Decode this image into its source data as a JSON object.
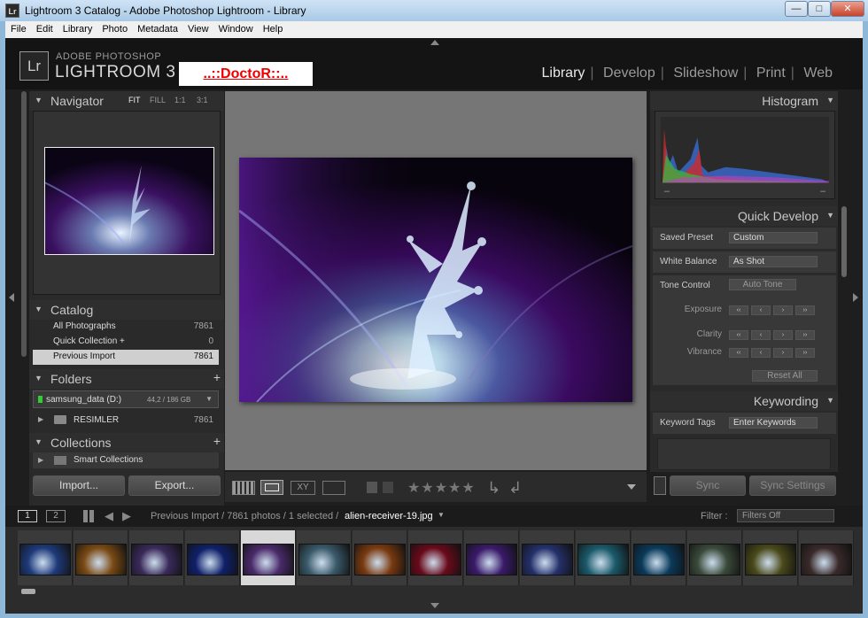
{
  "window": {
    "title": "Lightroom 3 Catalog - Adobe Photoshop Lightroom - Library",
    "app_icon": "Lr",
    "btn_min": "—",
    "btn_max": "□",
    "btn_close": "✕"
  },
  "menubar": [
    "File",
    "Edit",
    "Library",
    "Photo",
    "Metadata",
    "View",
    "Window",
    "Help"
  ],
  "identity": {
    "logo": "Lr",
    "line1": "ADOBE PHOTOSHOP",
    "line2": "LIGHTROOM 3",
    "plate": "..::DoctoR::.."
  },
  "modules": {
    "library": "Library",
    "develop": "Develop",
    "slideshow": "Slideshow",
    "print": "Print",
    "web": "Web",
    "sep": "|"
  },
  "navigator": {
    "title": "Navigator",
    "fit": "FIT",
    "fill": "FILL",
    "z1": "1:1",
    "z3": "3:1"
  },
  "catalog": {
    "title": "Catalog",
    "items": [
      {
        "label": "All Photographs",
        "count": "7861"
      },
      {
        "label": "Quick Collection  +",
        "count": "0"
      },
      {
        "label": "Previous Import",
        "count": "7861"
      }
    ]
  },
  "folders": {
    "title": "Folders",
    "plus": "+",
    "volume": "samsung_data (D:)",
    "volume_size": "44,2 / 186 GB",
    "folder": "RESIMLER",
    "folder_count": "7861"
  },
  "collections": {
    "title": "Collections",
    "plus": "+",
    "smart": "Smart Collections"
  },
  "left_buttons": {
    "import": "Import...",
    "export": "Export..."
  },
  "toolbar": {
    "stars": "★★★★★"
  },
  "histogram": {
    "title": "Histogram"
  },
  "quick_develop": {
    "title": "Quick Develop",
    "saved_preset_label": "Saved Preset",
    "saved_preset_value": "Custom",
    "white_balance_label": "White Balance",
    "white_balance_value": "As Shot",
    "tone_control_label": "Tone Control",
    "auto_tone": "Auto Tone",
    "exposure": "Exposure",
    "clarity": "Clarity",
    "vibrance": "Vibrance",
    "reset_all": "Reset All",
    "step_ll": "‹‹",
    "step_l": "‹",
    "step_r": "›",
    "step_rr": "››"
  },
  "keywording": {
    "title": "Keywording",
    "keyword_tags_label": "Keyword Tags",
    "keyword_tags_value": "Enter Keywords"
  },
  "right_buttons": {
    "sync": "Sync",
    "sync_settings": "Sync Settings"
  },
  "filmstrip": {
    "screen1": "1",
    "screen2": "2",
    "path_prefix": "Previous Import / 7861 photos / 1 selected /",
    "filename": "alien-receiver-19.jpg",
    "filter_label": "Filter :",
    "filter_value": "Filters Off"
  },
  "thumbs": [
    "#1e3a7a",
    "#7a4a14",
    "#3a2a5a",
    "#10206a",
    "#4a2a6a",
    "#3a5a6a",
    "#7a3a10",
    "#6a0a1a",
    "#3a1a6a",
    "#24306a",
    "#1a5a6a",
    "#0a3a5a",
    "#3a4a3a",
    "#4a4a1a",
    "#3a2a2a"
  ],
  "colors": {
    "accent": "#e00000",
    "panel": "#2a2a2a"
  }
}
